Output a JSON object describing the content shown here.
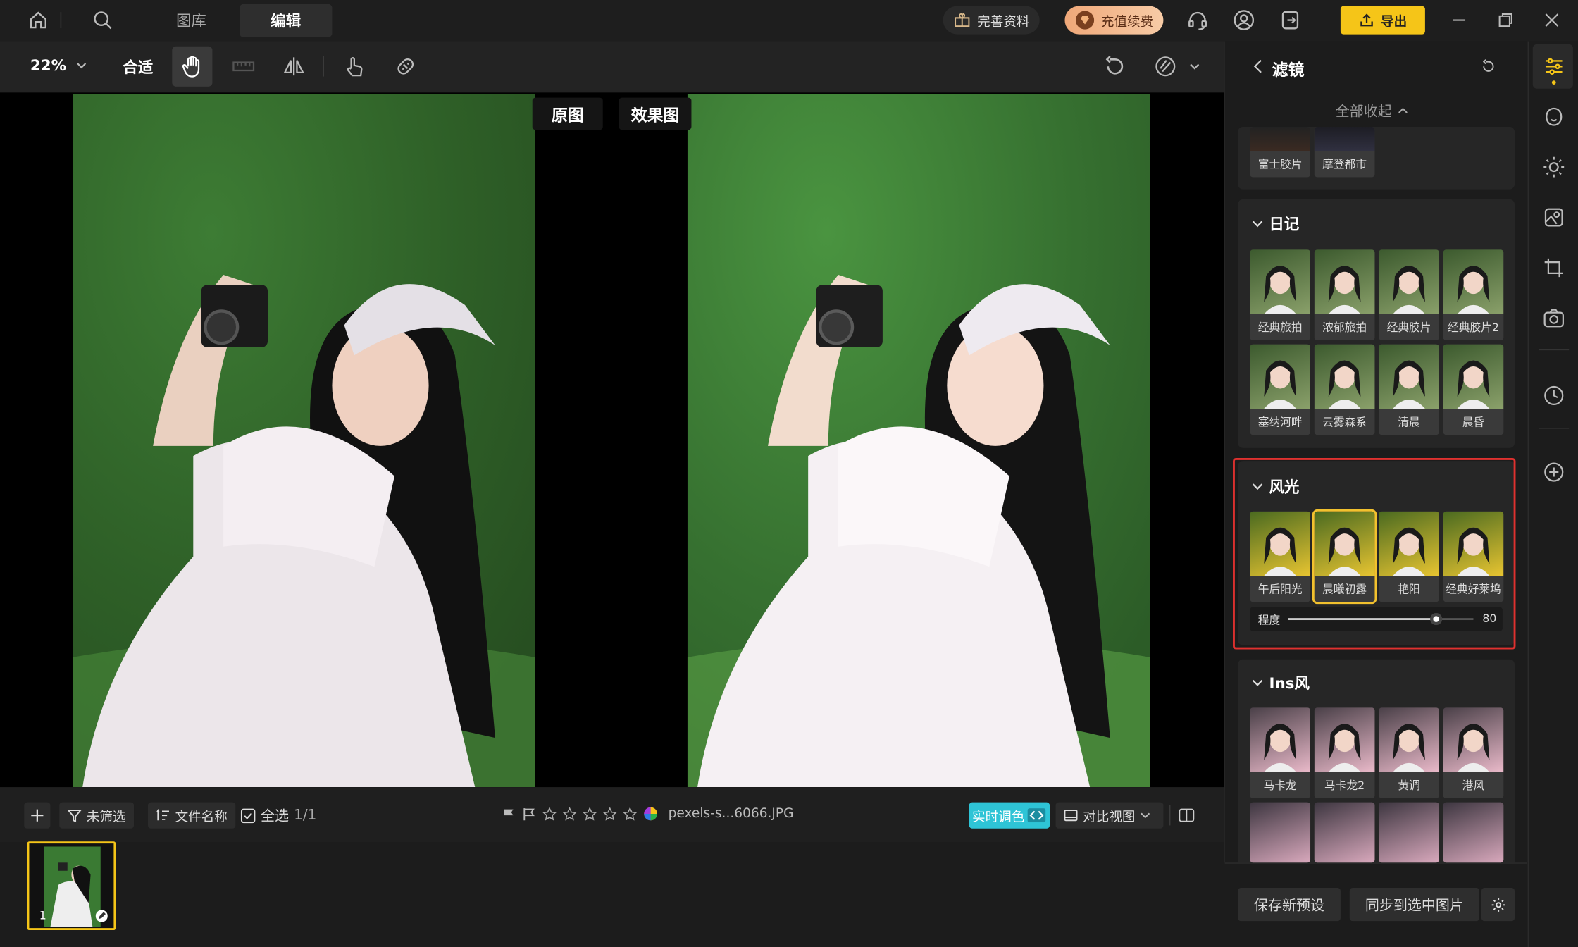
{
  "topbar": {
    "tabs": [
      "图库",
      "编辑"
    ],
    "perfect_profile": "完善资料",
    "recharge": "充值续费",
    "export": "导出"
  },
  "toolbar": {
    "zoom": "22%",
    "fit": "合适"
  },
  "canvas": {
    "original_label": "原图",
    "effect_label": "效果图"
  },
  "bottom": {
    "unfiltered": "未筛选",
    "file_name": "文件名称",
    "select_all": "全选",
    "count": "1/1",
    "filename": "pexels-s...6066.JPG",
    "realtime": "实时调色",
    "compare_view": "对比视图",
    "thumb_index": "1"
  },
  "panel": {
    "title": "滤镜",
    "collapse_all": "全部收起",
    "top_items": [
      "富士胶片",
      "摩登都市"
    ],
    "diary": {
      "title": "日记",
      "items": [
        "经典旅拍",
        "浓郁旅拍",
        "经典胶片",
        "经典胶片2",
        "塞纳河畔",
        "云雾森系",
        "清晨",
        "晨昏"
      ]
    },
    "scenery": {
      "title": "风光",
      "items": [
        "午后阳光",
        "晨曦初露",
        "艳阳",
        "经典好莱坞"
      ],
      "selected": 1,
      "degree_label": "程度",
      "degree_value": "80",
      "degree_fraction": 0.8
    },
    "ins": {
      "title": "Ins风",
      "items": [
        "马卡龙",
        "马卡龙2",
        "黄调",
        "港风"
      ]
    },
    "save_preset": "保存新预设",
    "sync": "同步到选中图片"
  },
  "colors": {
    "accent_yellow": "#f5c518",
    "teal": "#2ec4d6",
    "highlight_red": "#e0312f"
  }
}
